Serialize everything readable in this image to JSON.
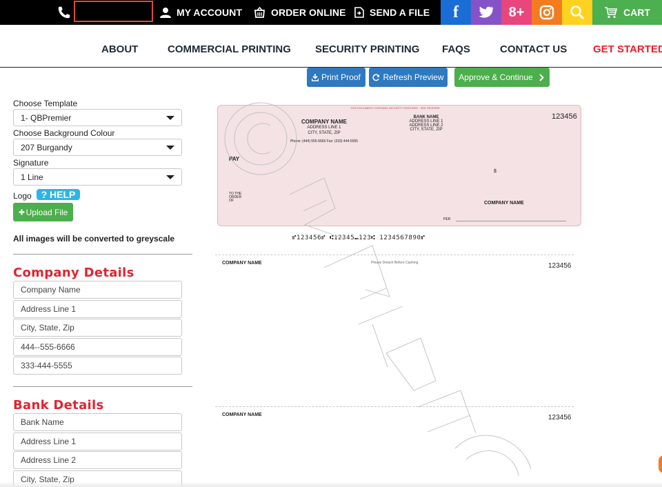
{
  "topbar": {
    "search_value": "",
    "my_account": "MY ACCOUNT",
    "order_online": "ORDER ONLINE",
    "send_a_file": "SEND A FILE",
    "facebook_glyph": "f",
    "gplus_glyph": "8+",
    "cart": "CART"
  },
  "nav": {
    "about": "ABOUT",
    "commercial": "COMMERCIAL PRINTING",
    "security": "SECURITY PRINTING",
    "faqs": "FAQS",
    "contact": "CONTACT US",
    "get_started": "GET STARTED"
  },
  "actions": {
    "print_proof": "Print Proof",
    "refresh_preview": "Refresh Preview",
    "approve_continue": "Approve & Continue"
  },
  "options": {
    "template_label": "Choose Template",
    "template_value": "1- QBPremier",
    "background_label": "Choose Background Colour",
    "background_value": "207 Burgandy",
    "signature_label": "Signature",
    "signature_value": "1 Line",
    "logo_label": "Logo",
    "help": "? HELP",
    "upload": "Upload File",
    "greyscale_note": "All images will be converted to greyscale"
  },
  "company_details": {
    "title": "Company Details",
    "fields": [
      "Company Name",
      "Address Line 1",
      "City, State, Zip",
      "444--555-6666",
      "333-444-5555"
    ]
  },
  "bank_details": {
    "title": "Bank Details",
    "fields": [
      "Bank Name",
      "Address Line 1",
      "Address Line 2",
      "City, State, Zip"
    ]
  },
  "cheque": {
    "security_note": "THIS DOCUMENT CONTAINS SECURITY FEATURES - SEE REVERSE",
    "company_name": "COMPANY NAME",
    "address_line_1": "ADDRESS LINE 1",
    "city_state_zip": "CITY, STATE, ZIP",
    "phone_line": "Phone: (444) 555-6666 Fax: (333) 444-5555",
    "bank_name": "BANK NAME",
    "bank_address_1": "ADDRESS LINE 1",
    "bank_address_2": "ADDRESS LINE 2",
    "bank_city": "CITY, STATE, ZIP",
    "number": "123456",
    "pay": "PAY",
    "dollar": "$",
    "to_the_order_of": "TO THE\nORDER\nOF",
    "payee_company": "COMPANY NAME",
    "per": "PER",
    "micr": "⑈123456⑈ ⑆12345⑉123⑆ 1234567890⑈"
  },
  "stubs": {
    "company_name": "COMPANY NAME",
    "detach_note": "Please Detach Before Cashing",
    "number": "123456"
  },
  "colors": {
    "accent_red": "#e0242f",
    "primary_blue": "#2e79bf",
    "success_green": "#4cae4c",
    "help_blue": "#2bb5e8",
    "cheque_pink": "#f4e2e4"
  },
  "icons": [
    "phone-icon",
    "user-icon",
    "basket-icon",
    "upload-file-icon",
    "facebook-icon",
    "twitter-icon",
    "google-plus-icon",
    "instagram-icon",
    "search-icon",
    "cart-icon",
    "download-icon",
    "refresh-icon",
    "chevron-right-icon",
    "plus-icon"
  ]
}
